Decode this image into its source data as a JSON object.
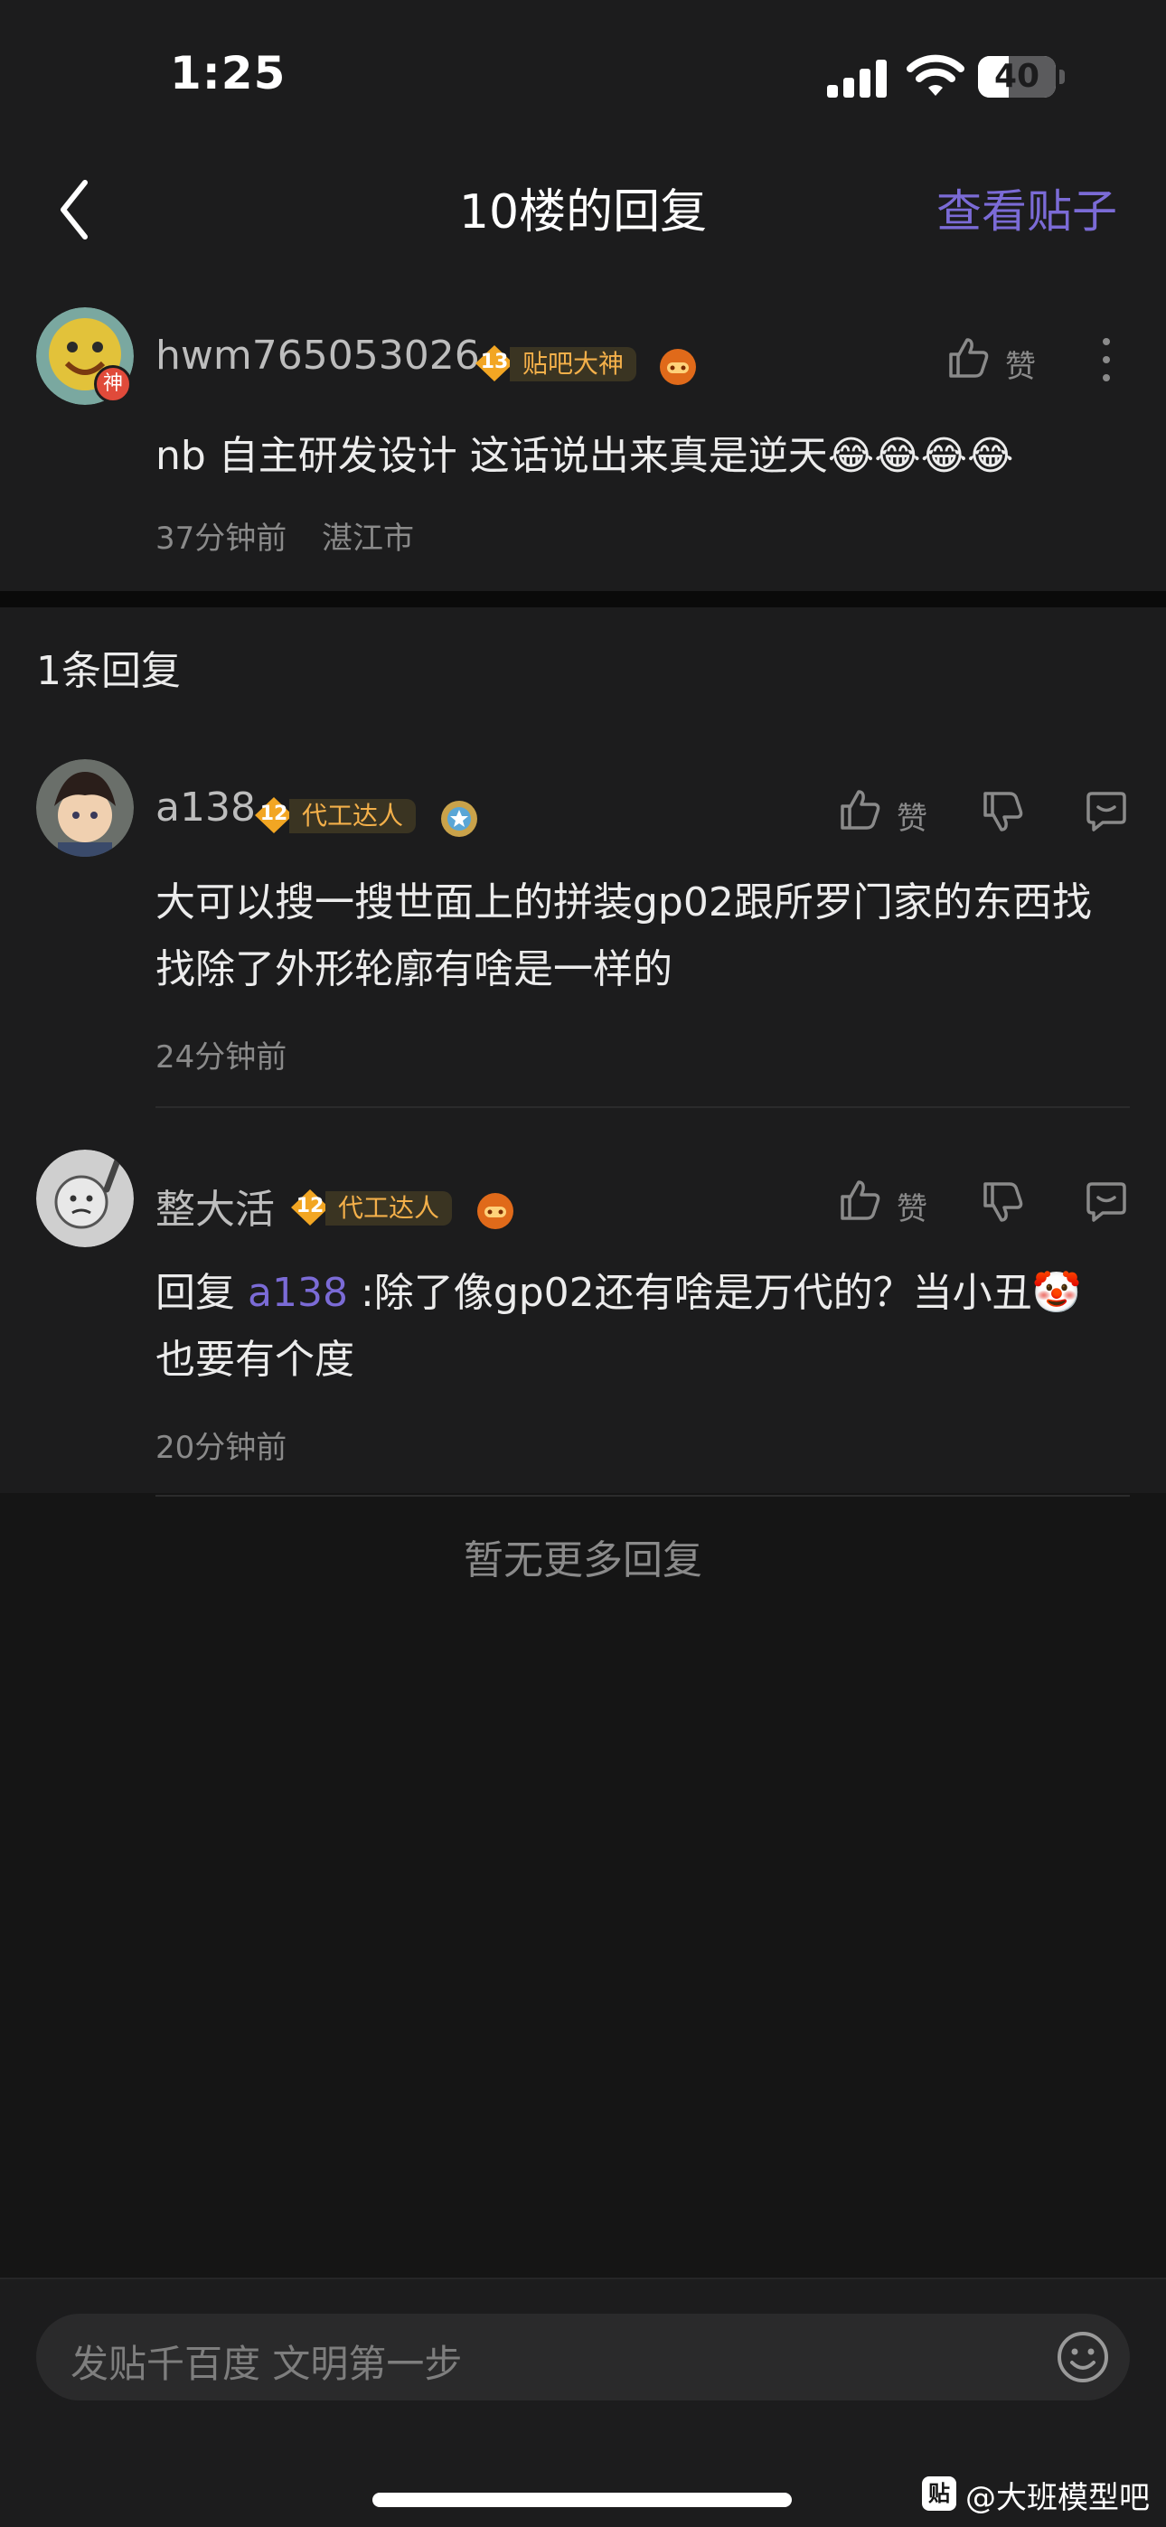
{
  "status": {
    "time": "1:25",
    "battery": "40",
    "battery_level": 0.4
  },
  "nav": {
    "title": "10楼的回复",
    "action": "查看贴子"
  },
  "main_post": {
    "username": "hwm765053026",
    "level": "13",
    "level_title": "贴吧大神",
    "avatar_badge": "神",
    "text": "nb 自主研发设计 这话说出来真是逆天😂😂😂😂",
    "time": "37分钟前",
    "location": "湛江市",
    "like_label": "赞"
  },
  "replies_count": "1条回复",
  "replies": [
    {
      "username": "a138",
      "level": "12",
      "level_title": "代工达人",
      "text": "大可以搜一搜世面上的拼装gp02跟所罗门家的东西找找除了外形轮廓有啥是一样的",
      "time": "24分钟前",
      "like_label": "赞"
    },
    {
      "username": "整大活",
      "level": "12",
      "level_title": "代工达人",
      "reply_prefix": "回复 ",
      "reply_to": "a138",
      "text": " :除了像gp02还有啥是万代的？当小丑🤡也要有个度",
      "time": "20分钟前",
      "like_label": "赞"
    }
  ],
  "no_more": "暂无更多回复",
  "input": {
    "placeholder": "发贴千百度 文明第一步"
  },
  "watermark": {
    "logo": "贴",
    "text": "@大班模型吧"
  },
  "colors": {
    "accent": "#7b6bd6",
    "level_text": "#f4b04a",
    "background": "#151515",
    "panel": "#1c1c1d"
  }
}
